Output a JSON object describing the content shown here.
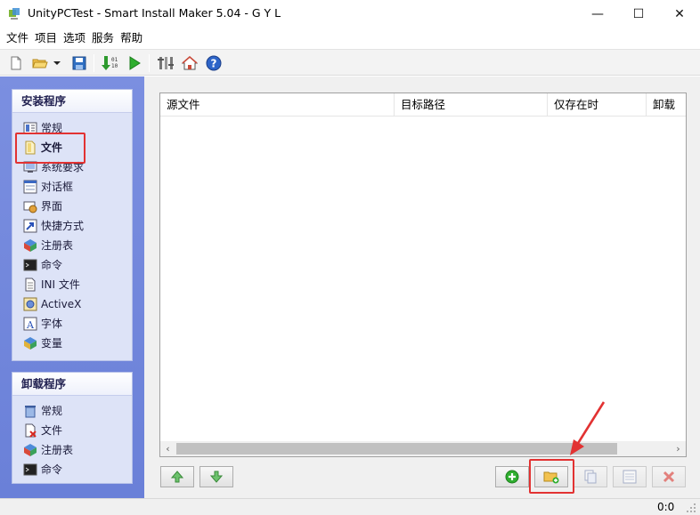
{
  "window": {
    "title": "UnityPCTest - Smart Install Maker 5.04 - G Y L",
    "minimize": "—",
    "maximize": "☐",
    "close": "✕"
  },
  "menu": [
    "文件",
    "项目",
    "选项",
    "服务",
    "帮助"
  ],
  "toolbar": {
    "icons": [
      "new-file-icon",
      "open-folder-icon",
      "dropdown-arrow-icon",
      "save-icon",
      "compile-icon",
      "run-icon",
      "settings-icon",
      "home-icon",
      "help-icon"
    ]
  },
  "install_panel": {
    "header": "安装程序",
    "items": [
      {
        "label": "常规",
        "icon": "general-icon"
      },
      {
        "label": "文件",
        "icon": "files-icon"
      },
      {
        "label": "系统要求",
        "icon": "requirements-icon"
      },
      {
        "label": "对话框",
        "icon": "dialogs-icon"
      },
      {
        "label": "界面",
        "icon": "interface-icon"
      },
      {
        "label": "快捷方式",
        "icon": "shortcut-icon"
      },
      {
        "label": "注册表",
        "icon": "registry-icon"
      },
      {
        "label": "命令",
        "icon": "command-icon"
      },
      {
        "label": "INI 文件",
        "icon": "ini-file-icon"
      },
      {
        "label": "ActiveX",
        "icon": "activex-icon"
      },
      {
        "label": "字体",
        "icon": "font-icon"
      },
      {
        "label": "变量",
        "icon": "variables-icon"
      }
    ],
    "selected_index": 1
  },
  "uninstall_panel": {
    "header": "卸载程序",
    "items": [
      {
        "label": "常规",
        "icon": "trash-icon"
      },
      {
        "label": "文件",
        "icon": "delete-files-icon"
      },
      {
        "label": "注册表",
        "icon": "registry-icon"
      },
      {
        "label": "命令",
        "icon": "command-icon"
      }
    ]
  },
  "file_list": {
    "columns": [
      "源文件",
      "目标路径",
      "仅存在时",
      "卸载"
    ],
    "rows": []
  },
  "buttons": {
    "move_up": "move-up-icon",
    "move_down": "move-down-icon",
    "add_file": "add-icon",
    "add_folder": "add-folder-icon",
    "copy": "copy-icon",
    "properties": "properties-icon",
    "delete": "delete-icon"
  },
  "status": {
    "position": "0:0"
  },
  "colors": {
    "nav_background": "#6a80d8",
    "annotation_red": "#e23232"
  }
}
